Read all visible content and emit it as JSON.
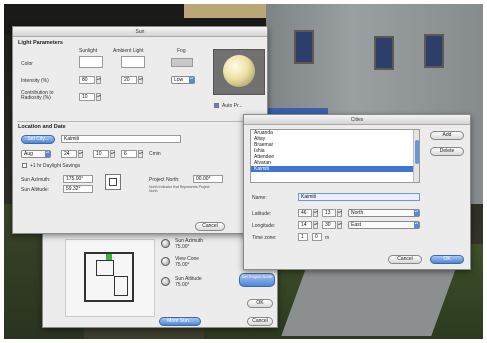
{
  "sun_dialog": {
    "title": "Sun",
    "light_section": "Light Parameters",
    "col_sunlight": "Sunlight",
    "col_ambient": "Ambient Light",
    "col_fog": "Fog",
    "row_color": "Color",
    "row_intensity": "Intensity (%)",
    "intensity_sun": "80",
    "intensity_ambient": "20",
    "fog_value": "Low",
    "row_contribution": "Contribution to Radiosity (%)",
    "contribution_value": "10",
    "autopreview": "Auto Pr...",
    "location_section": "Location and Date",
    "set_city_button": "Set City...",
    "city_value": "Kaimiti",
    "month_value": "Aug",
    "day_value": "24",
    "hour_value": "10",
    "minute_value": "6",
    "time_unit": "Cmin",
    "daylight_saving": "+1 hr Daylight Savings",
    "sun_azimuth_label": "Sun Azimuth:",
    "sun_azimuth_value": "175.00°",
    "sun_altitude_label": "Sun Altitude:",
    "sun_altitude_value": "59.32°",
    "project_north_label": "Project North:",
    "project_north_value": "00.00°",
    "project_north_note": "North Indicator that Represents Project North",
    "cancel_button": "Cancel"
  },
  "plan_panel": {
    "sun_azimuth": "Sun Azimuth",
    "sun_azimuth_value": "75.00°",
    "view_cone": "View Cone",
    "view_cone_value": "75.00°",
    "sun_altitude": "Sun Altitude",
    "sun_altitude_value": "75.00°",
    "set_north_label": "Set Project North",
    "ok_button": "OK",
    "cancel_button": "Cancel",
    "more_sun_button": "More Sun..."
  },
  "city_dialog": {
    "title": "Cities",
    "cities": [
      "Aruanda",
      "Altay",
      "Braemar",
      "Ishia",
      "Attendee",
      "Alvaran",
      "Kaimiti"
    ],
    "selected_index": 6,
    "add_button": "Add",
    "delete_button": "Delete",
    "name_label": "Name:",
    "name_value": "Kaimiti",
    "latitude_label": "Latitude:",
    "lat_deg": "46",
    "lat_min": "13",
    "lat_dir": "North",
    "longitude_label": "Longitude:",
    "lon_deg": "14",
    "lon_min": "30",
    "lon_dir": "East",
    "timezone_label": "Time zone:",
    "tz_value": "1",
    "tz_minutes": "0",
    "tz_unit": "m",
    "cancel_button": "Cancel",
    "ok_button": "OK"
  },
  "colors": {
    "accent_blue": "#4d86d6",
    "selection_blue": "#3f76d2"
  }
}
